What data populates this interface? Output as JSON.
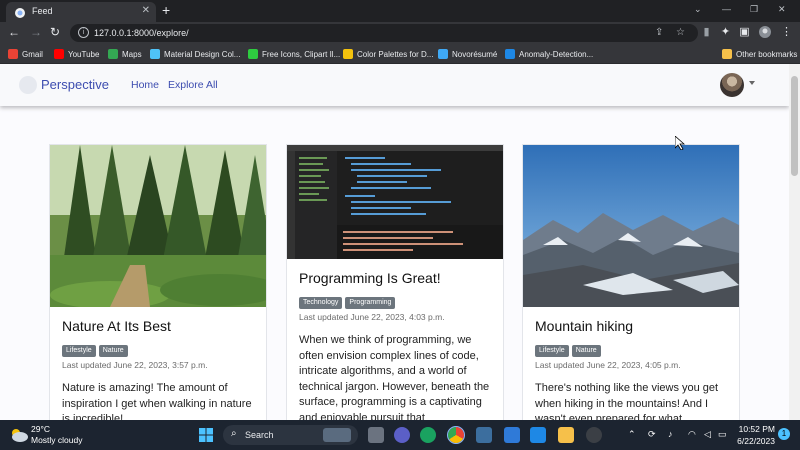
{
  "browser": {
    "tab_title": "Feed",
    "tab_close": "✕",
    "new_tab": "+",
    "url": "127.0.0.1:8000/explore/",
    "window_controls": [
      "⌄",
      "—",
      "❐",
      "✕"
    ],
    "bookmarks": [
      {
        "label": "Gmail",
        "color": "#ea4335"
      },
      {
        "label": "YouTube",
        "color": "#ff0000"
      },
      {
        "label": "Maps",
        "color": "#34a853"
      },
      {
        "label": "Material Design Col...",
        "color": "#4fc3f7"
      },
      {
        "label": "Free Icons, Clipart Il...",
        "color": "#2ecc40"
      },
      {
        "label": "Color Palettes for D...",
        "color": "#f4c20d"
      },
      {
        "label": "Novorésumé",
        "color": "#3fa9f5"
      },
      {
        "label": "Anomaly-Detection...",
        "color": "#1e88e5"
      }
    ],
    "other_bookmarks": "Other bookmarks"
  },
  "site": {
    "brand": "Perspective",
    "nav": [
      "Home",
      "Explore All"
    ]
  },
  "cards": [
    {
      "title": "Nature At Its Best",
      "tags": [
        "Lifestyle",
        "Nature"
      ],
      "updated": "Last updated June 22, 2023, 3:57 p.m.",
      "desc": "Nature is amazing! The amount of inspiration I get when walking in nature is incredible!"
    },
    {
      "title": "Programming Is Great!",
      "tags": [
        "Technology",
        "Programming"
      ],
      "updated": "Last updated June 22, 2023, 4:03 p.m.",
      "desc": "When we think of programming, we often envision complex lines of code, intricate algorithms, and a world of technical jargon. However, beneath the surface, programming is a captivating and enjoyable pursuit that"
    },
    {
      "title": "Mountain hiking",
      "tags": [
        "Lifestyle",
        "Nature"
      ],
      "updated": "Last updated June 22, 2023, 4:05 p.m.",
      "desc": "There's nothing like the views you get when hiking in the mountains! And I wasn't even prepared for what"
    }
  ],
  "taskbar": {
    "temp": "29°C",
    "weather": "Mostly cloudy",
    "search": "Search",
    "time": "10:52 PM",
    "date": "6/22/2023",
    "notification_count": "1"
  }
}
